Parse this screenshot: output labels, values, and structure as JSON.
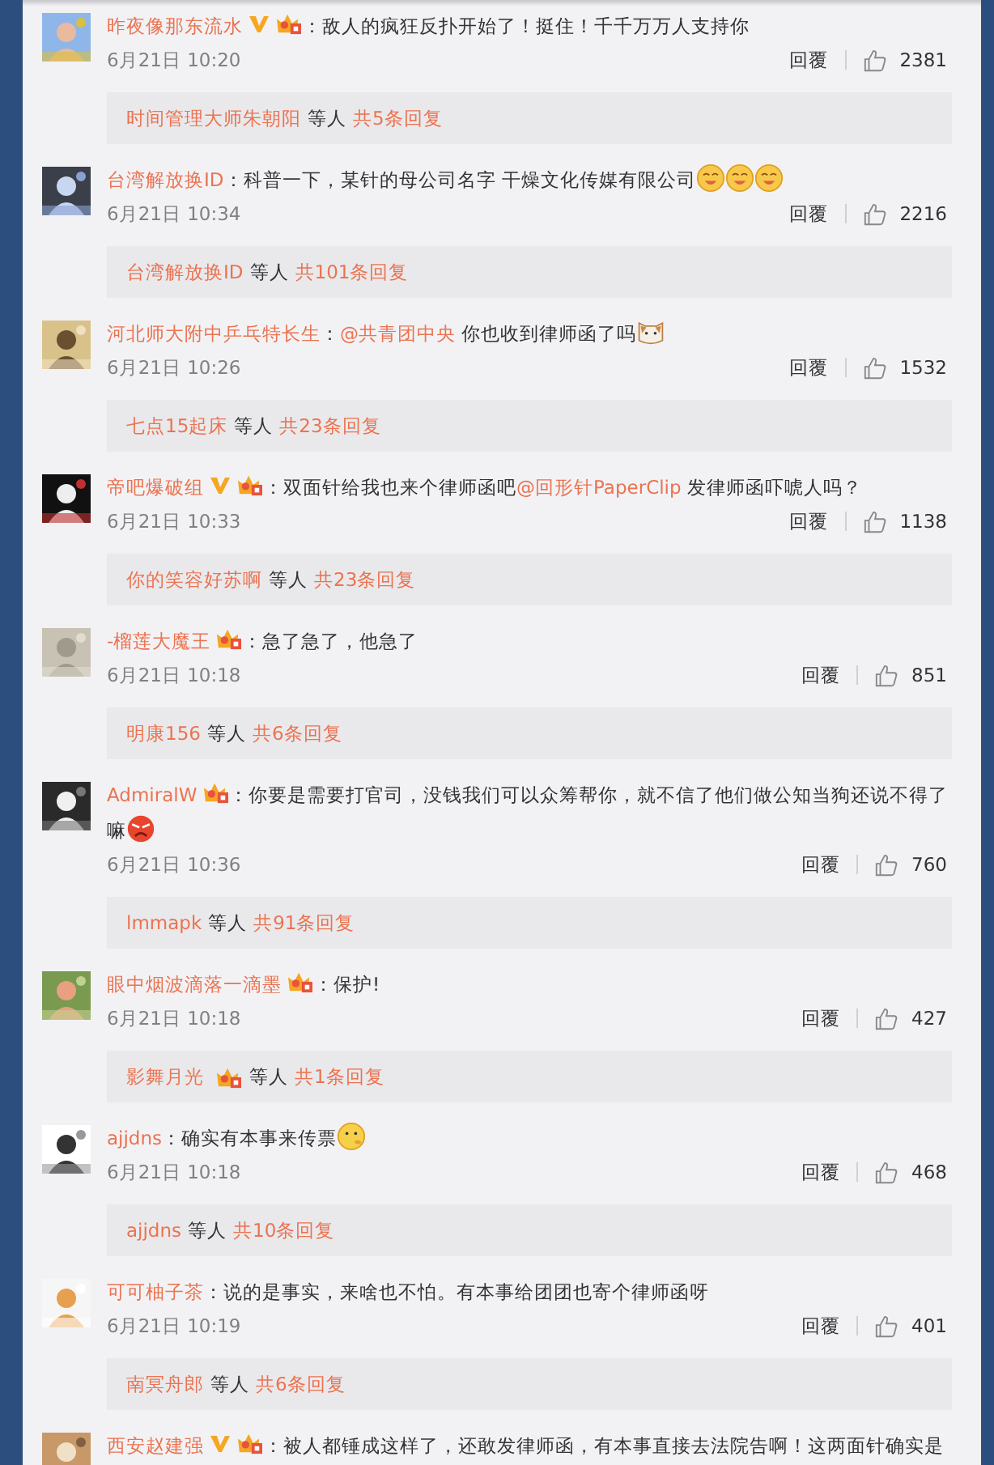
{
  "comments": [
    {
      "user": "昨夜像那东流水",
      "verified": true,
      "vip": true,
      "content": [
        {
          "kind": "text",
          "text": "：敌人的疯狂反扑开始了！挺住！千千万万人支持你"
        }
      ],
      "time": "6月21日 10:20",
      "reply_label": "回覆",
      "likes": "2381",
      "thread": {
        "names": [
          {
            "name": "时间管理大师朱朝阳"
          }
        ],
        "etc": "等人",
        "total": "共5条回复"
      }
    },
    {
      "user": "台湾解放换ID",
      "content": [
        {
          "kind": "text",
          "text": "：科普一下，某针的母公司名字 干燥文化传媒有限公司"
        },
        {
          "kind": "emoji-smile"
        },
        {
          "kind": "emoji-smile"
        },
        {
          "kind": "emoji-smile"
        }
      ],
      "time": "6月21日 10:34",
      "reply_label": "回覆",
      "likes": "2216",
      "thread": {
        "names": [
          {
            "name": "台湾解放换ID"
          }
        ],
        "etc": "等人",
        "total": "共101条回复"
      }
    },
    {
      "user": "河北师大附中乒乓特长生",
      "content": [
        {
          "kind": "text",
          "text": "："
        },
        {
          "kind": "mention",
          "text": "@共青团中央"
        },
        {
          "kind": "text",
          "text": " 你也收到律师函了吗"
        },
        {
          "kind": "emoji-cat"
        }
      ],
      "time": "6月21日 10:26",
      "reply_label": "回覆",
      "likes": "1532",
      "thread": {
        "names": [
          {
            "name": "七点15起床"
          }
        ],
        "etc": "等人",
        "total": "共23条回复"
      }
    },
    {
      "user": "帝吧爆破组",
      "verified": true,
      "vip": true,
      "content": [
        {
          "kind": "text",
          "text": "：双面针给我也来个律师函吧"
        },
        {
          "kind": "mention",
          "text": "@回形针PaperClip"
        },
        {
          "kind": "text",
          "text": " 发律师函吓唬人吗？"
        }
      ],
      "time": "6月21日 10:33",
      "reply_label": "回覆",
      "likes": "1138",
      "thread": {
        "names": [
          {
            "name": "你的笑容好苏啊"
          }
        ],
        "etc": "等人",
        "total": "共23条回复"
      }
    },
    {
      "user": "-榴莲大魔王",
      "vip": true,
      "content": [
        {
          "kind": "text",
          "text": "：急了急了，他急了"
        }
      ],
      "time": "6月21日 10:18",
      "reply_label": "回覆",
      "likes": "851",
      "thread": {
        "names": [
          {
            "name": "明康156"
          }
        ],
        "etc": "等人",
        "total": "共6条回复"
      }
    },
    {
      "user": "AdmiralW",
      "vip": true,
      "content": [
        {
          "kind": "text",
          "text": "：你要是需要打官司，没钱我们可以众筹帮你，就不信了他们做公知当狗还说不得了"
        },
        {
          "kind": "text",
          "text": "嘛"
        },
        {
          "kind": "emoji-angry"
        }
      ],
      "time": "6月21日 10:36",
      "reply_label": "回覆",
      "likes": "760",
      "thread": {
        "names": [
          {
            "name": "lmmapk"
          }
        ],
        "etc": "等人",
        "total": "共91条回复"
      }
    },
    {
      "user": "眼中烟波滴落一滴墨",
      "vip": true,
      "content": [
        {
          "kind": "text",
          "text": "：保护!"
        }
      ],
      "time": "6月21日 10:18",
      "reply_label": "回覆",
      "likes": "427",
      "thread": {
        "names": [
          {
            "name": "影舞月光",
            "vip": true
          }
        ],
        "etc": "等人",
        "total": "共1条回复"
      }
    },
    {
      "user": "ajjdns",
      "content": [
        {
          "kind": "text",
          "text": "：确实有本事来传票"
        },
        {
          "kind": "emoji-think"
        }
      ],
      "time": "6月21日 10:18",
      "reply_label": "回覆",
      "likes": "468",
      "thread": {
        "names": [
          {
            "name": "ajjdns"
          }
        ],
        "etc": "等人",
        "total": "共10条回复"
      }
    },
    {
      "user": "可可柚子茶",
      "content": [
        {
          "kind": "text",
          "text": "：说的是事实，来啥也不怕。有本事给团团也寄个律师函呀"
        }
      ],
      "time": "6月21日 10:19",
      "reply_label": "回覆",
      "likes": "401",
      "thread": {
        "names": [
          {
            "name": "南冥舟郎"
          }
        ],
        "etc": "等人",
        "total": "共6条回复"
      }
    },
    {
      "user": "西安赵建强",
      "verified": true,
      "vip": true,
      "content": [
        {
          "kind": "text",
          "text": "：被人都锤成这样了，还敢发律师函，有本事直接去法院告啊！这两面针确实是"
        }
      ]
    }
  ]
}
